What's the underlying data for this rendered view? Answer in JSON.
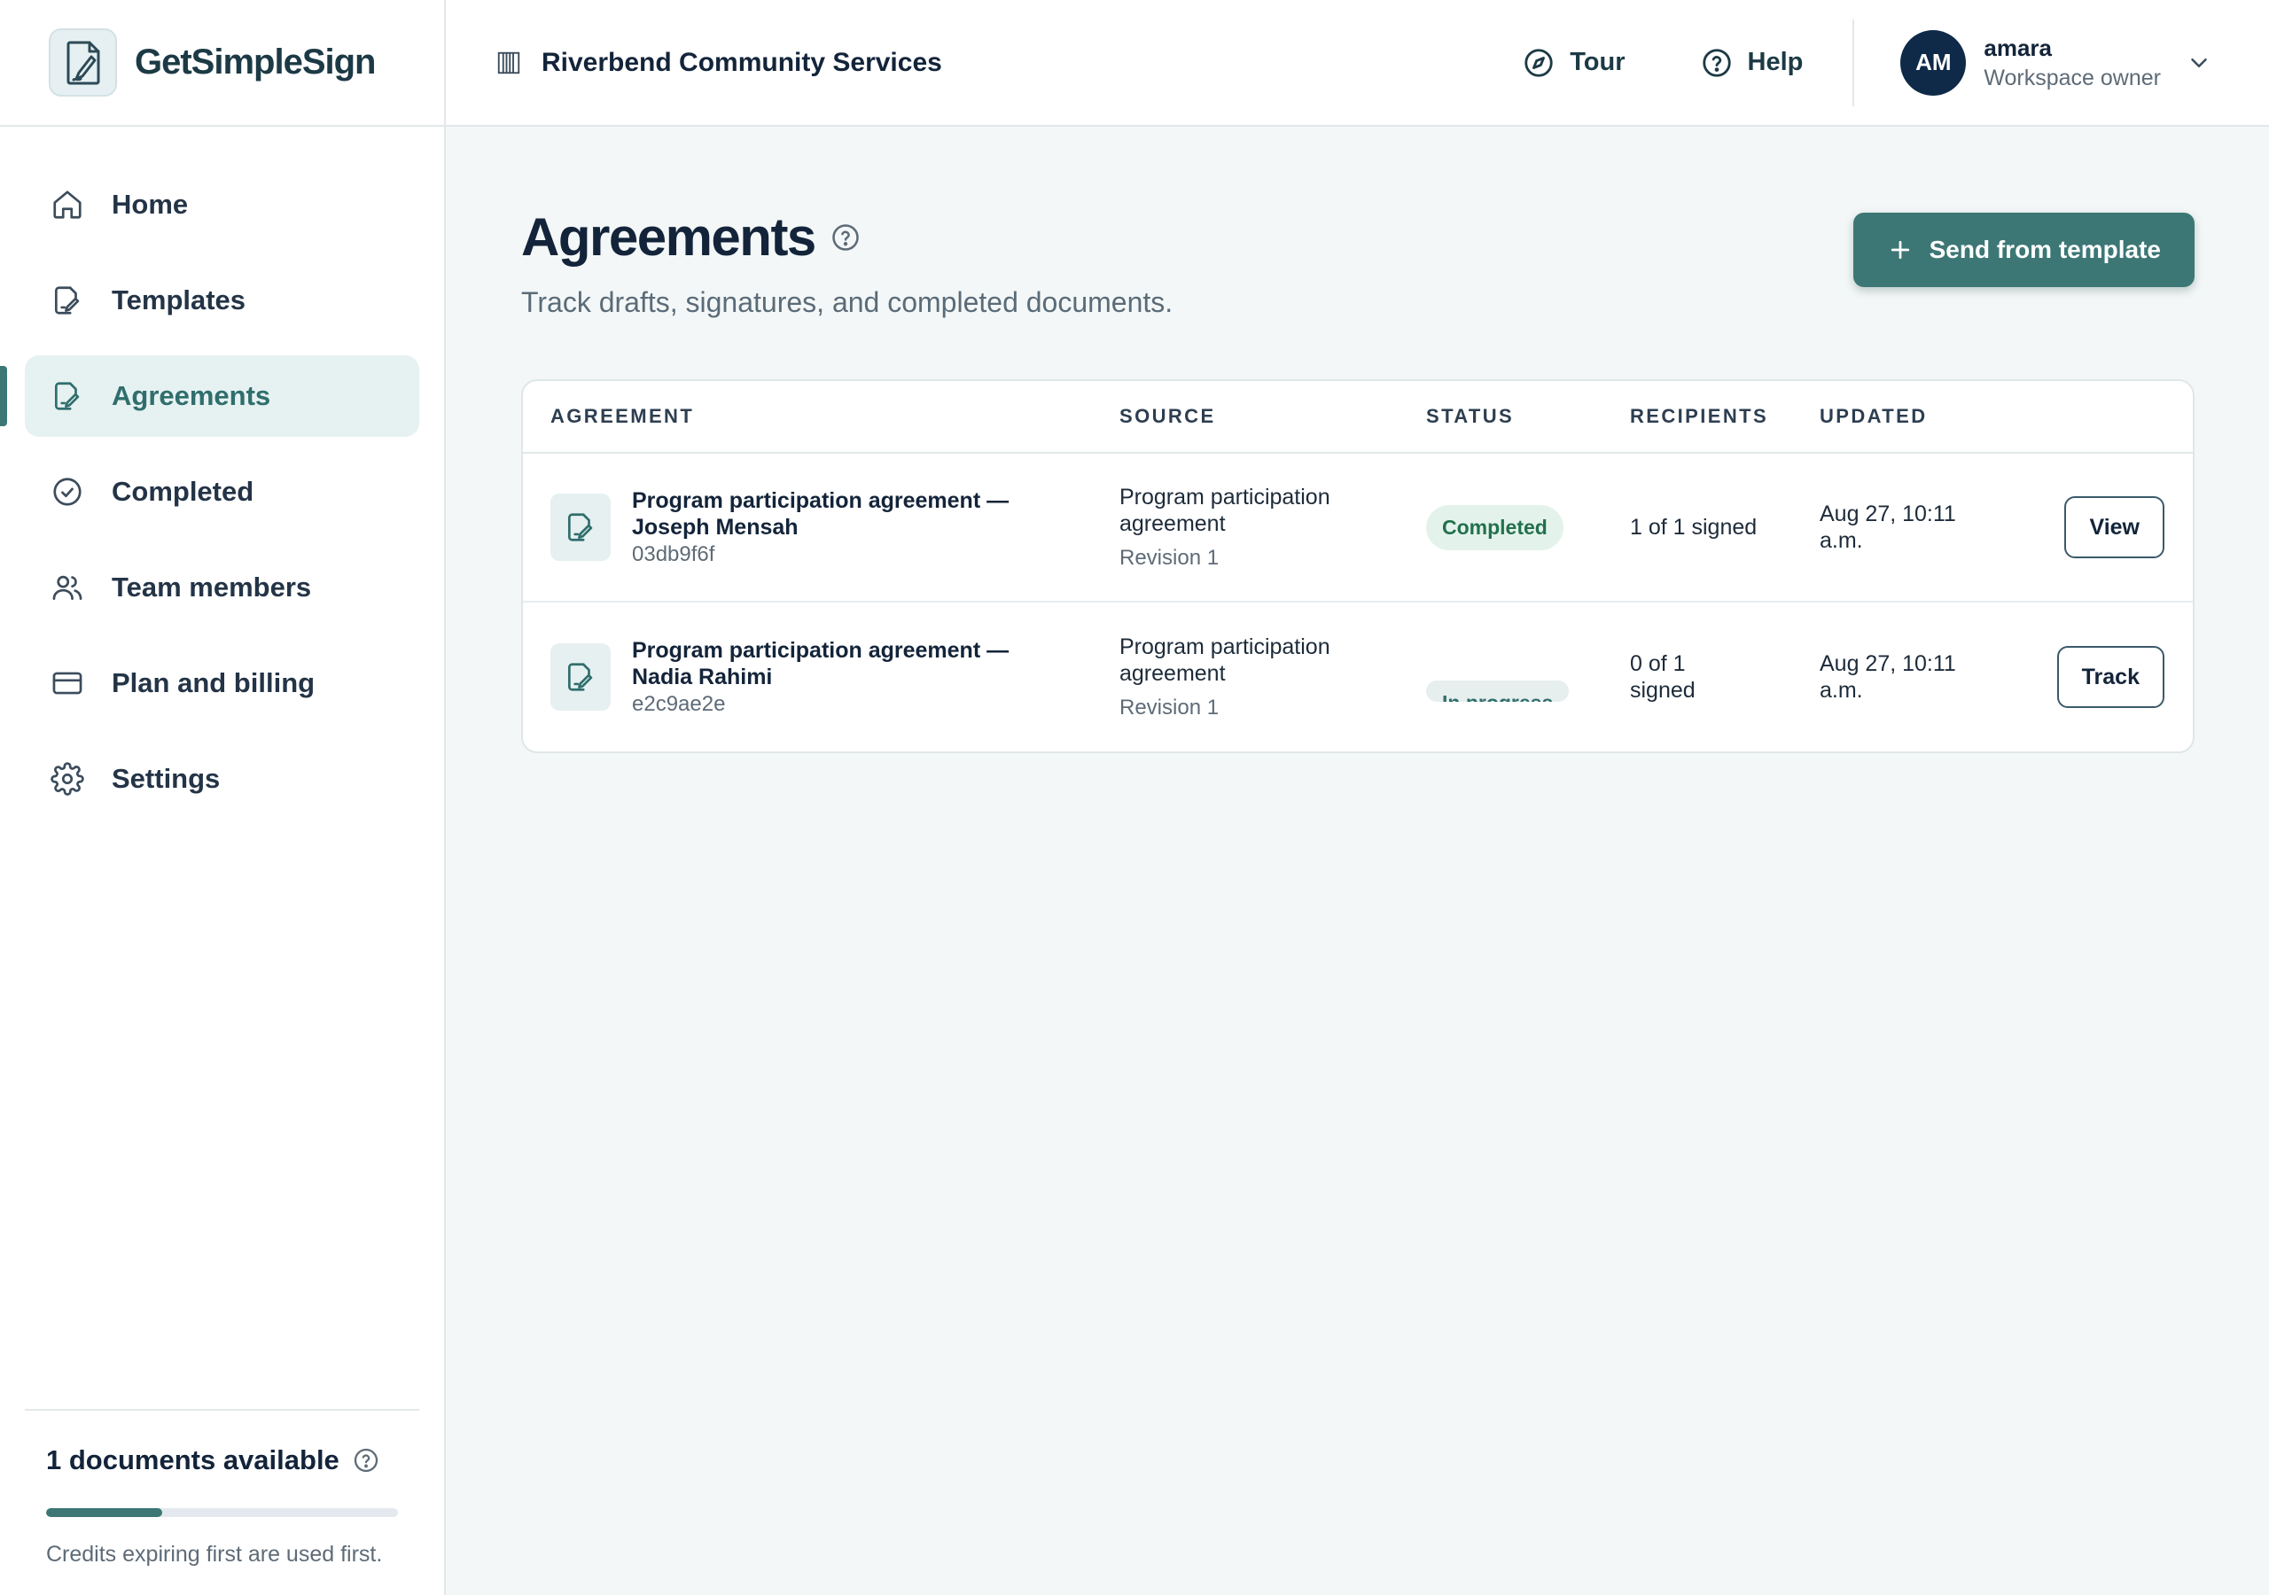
{
  "app": {
    "name": "GetSimpleSign"
  },
  "header": {
    "org_name": "Riverbend Community Services",
    "tour_label": "Tour",
    "help_label": "Help",
    "user": {
      "initials": "AM",
      "name": "amara",
      "role": "Workspace owner"
    }
  },
  "sidebar": {
    "items": [
      {
        "label": "Home",
        "icon": "home-icon"
      },
      {
        "label": "Templates",
        "icon": "template-icon"
      },
      {
        "label": "Agreements",
        "icon": "agreement-icon",
        "active": true
      },
      {
        "label": "Completed",
        "icon": "check-circle-icon"
      },
      {
        "label": "Team members",
        "icon": "users-icon"
      },
      {
        "label": "Plan and billing",
        "icon": "credit-card-icon"
      },
      {
        "label": "Settings",
        "icon": "gear-icon"
      }
    ],
    "credits": {
      "title": "1 documents available",
      "note": "Credits expiring first are used first.",
      "progress_percent": 33
    }
  },
  "main": {
    "title": "Agreements",
    "subtitle": "Track drafts, signatures, and completed documents.",
    "primary_button": "Send from template",
    "table": {
      "columns": [
        "AGREEMENT",
        "SOURCE",
        "STATUS",
        "RECIPIENTS",
        "UPDATED"
      ],
      "rows": [
        {
          "title": "Program participation agreement — Joseph Mensah",
          "id": "03db9f6f",
          "source": "Program participation agreement",
          "revision": "Revision 1",
          "status": "Completed",
          "recipients": "1 of 1 signed",
          "updated": "Aug 27, 10:11 a.m.",
          "action": "View"
        },
        {
          "title": "Program participation agreement — Nadia Rahimi",
          "id": "e2c9ae2e",
          "source": "Program participation agreement",
          "revision": "Revision 1",
          "status": "In progress",
          "recipients": "0 of 1 signed",
          "updated": "Aug 27, 10:11 a.m.",
          "action": "Track"
        }
      ]
    }
  },
  "colors": {
    "accent": "#3c7775",
    "avatar": "#0f2a48",
    "completed_badge": "#23704c",
    "background": "#f3f7f7"
  }
}
